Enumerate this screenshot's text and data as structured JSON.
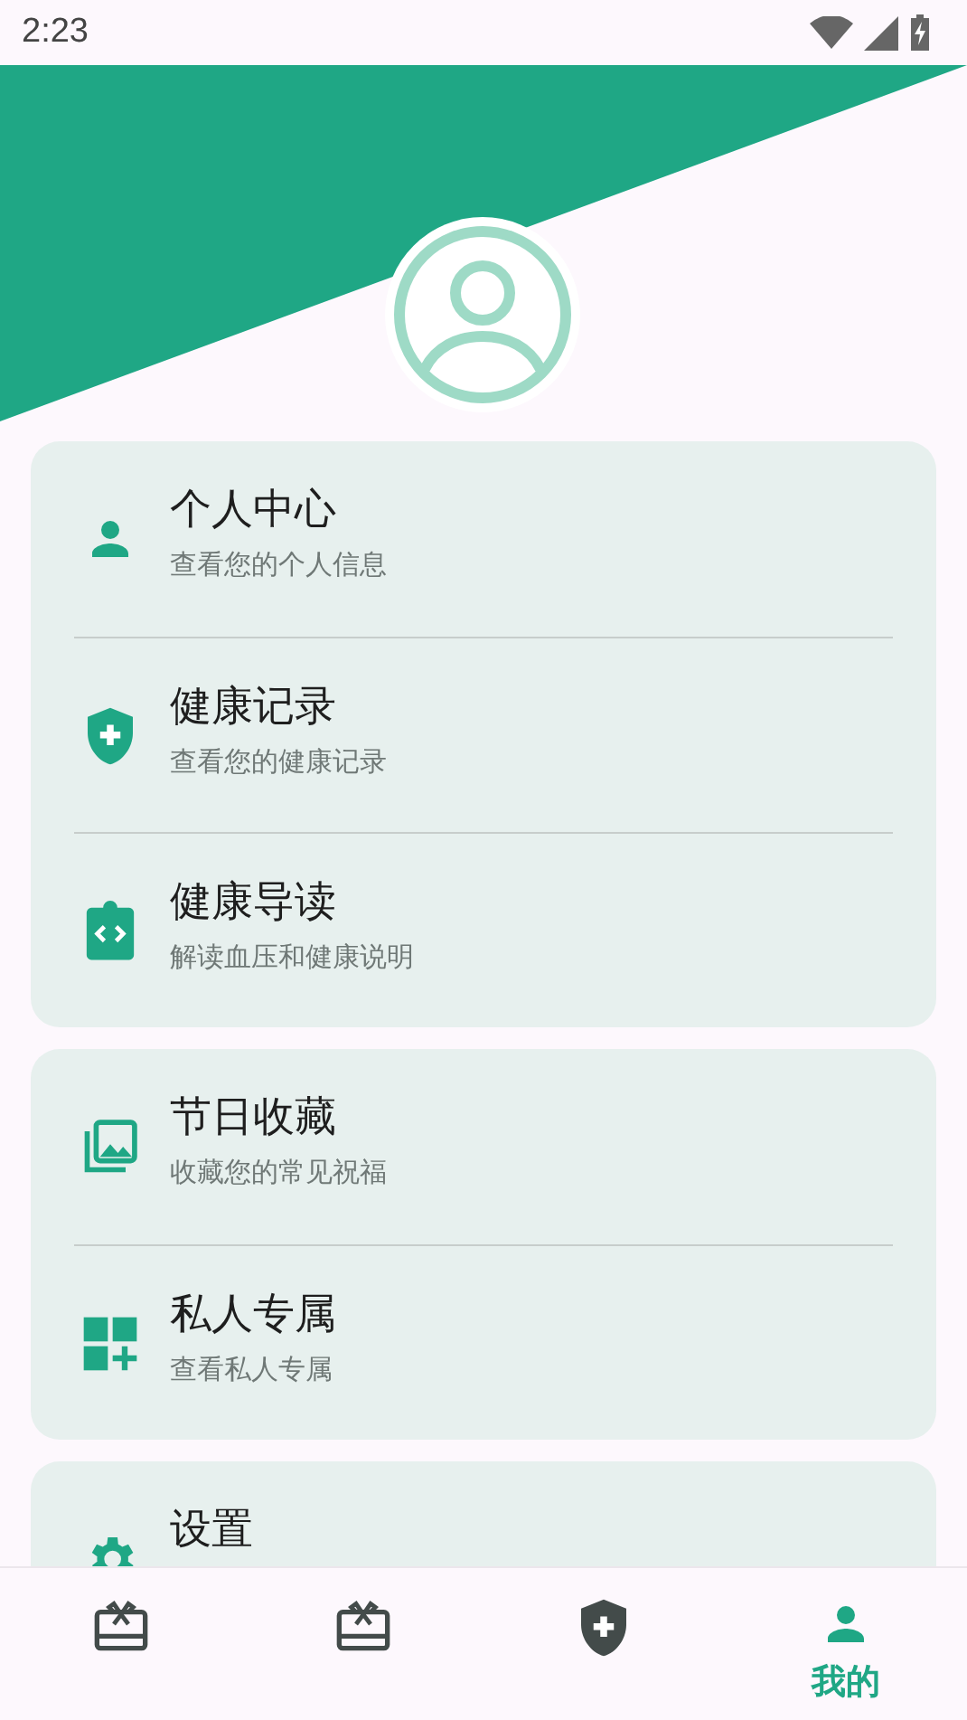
{
  "status_bar": {
    "time": "2:23"
  },
  "menu_groups": [
    {
      "items": [
        {
          "title": "个人中心",
          "subtitle": "查看您的个人信息"
        },
        {
          "title": "健康记录",
          "subtitle": "查看您的健康记录"
        },
        {
          "title": "健康导读",
          "subtitle": "解读血压和健康说明"
        }
      ]
    },
    {
      "items": [
        {
          "title": "节日收藏",
          "subtitle": "收藏您的常见祝福"
        },
        {
          "title": "私人专属",
          "subtitle": "查看私人专属"
        }
      ]
    },
    {
      "items": [
        {
          "title": "设置"
        }
      ]
    }
  ],
  "bottom_nav": [
    {
      "selected": false
    },
    {
      "selected": false
    },
    {
      "selected": false
    },
    {
      "label": "我的",
      "selected": true
    }
  ]
}
